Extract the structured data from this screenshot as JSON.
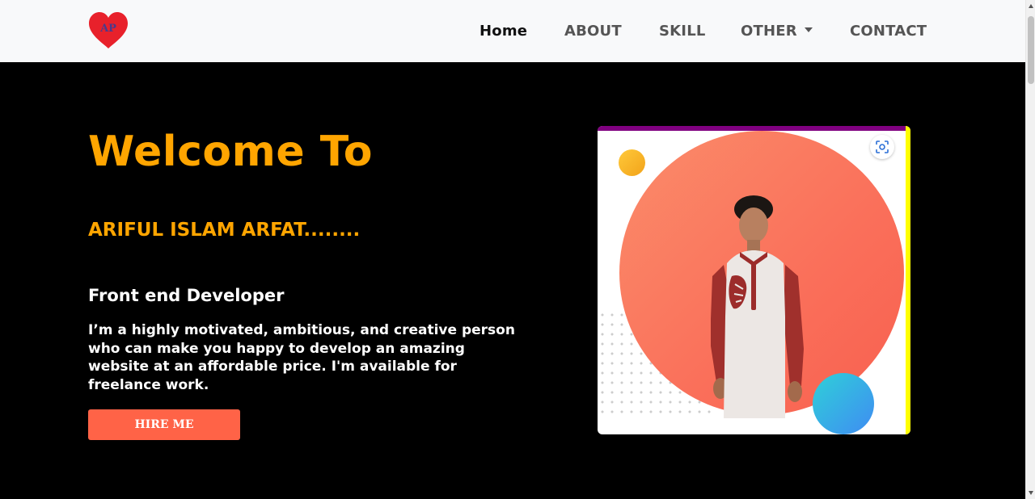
{
  "logo": {
    "text": "AP",
    "color": "#e8212b"
  },
  "nav": {
    "items": [
      {
        "label": "Home",
        "active": true
      },
      {
        "label": "ABOUT",
        "active": false
      },
      {
        "label": "SKILL",
        "active": false
      },
      {
        "label": "OTHER",
        "active": false,
        "dropdown": true
      },
      {
        "label": "CONTACT",
        "active": false
      }
    ]
  },
  "hero": {
    "heading": "Welcome To",
    "name": "ARIFUL ISLAM ARFAT........",
    "role": "Front end Developer",
    "bio": "I’m a highly motivated, ambitious, and creative person who can make you happy to develop an amazing website at an affordable price. I'm available for freelance work.",
    "cta_label": "HIRE ME"
  },
  "colors": {
    "accent": "#ffa500",
    "button": "#ff6347",
    "card_top": "#800080",
    "card_right": "#ffff00"
  },
  "icons": {
    "logo": "heart-logo-icon",
    "dropdown": "caret-down-icon",
    "lens": "visual-search-icon"
  }
}
